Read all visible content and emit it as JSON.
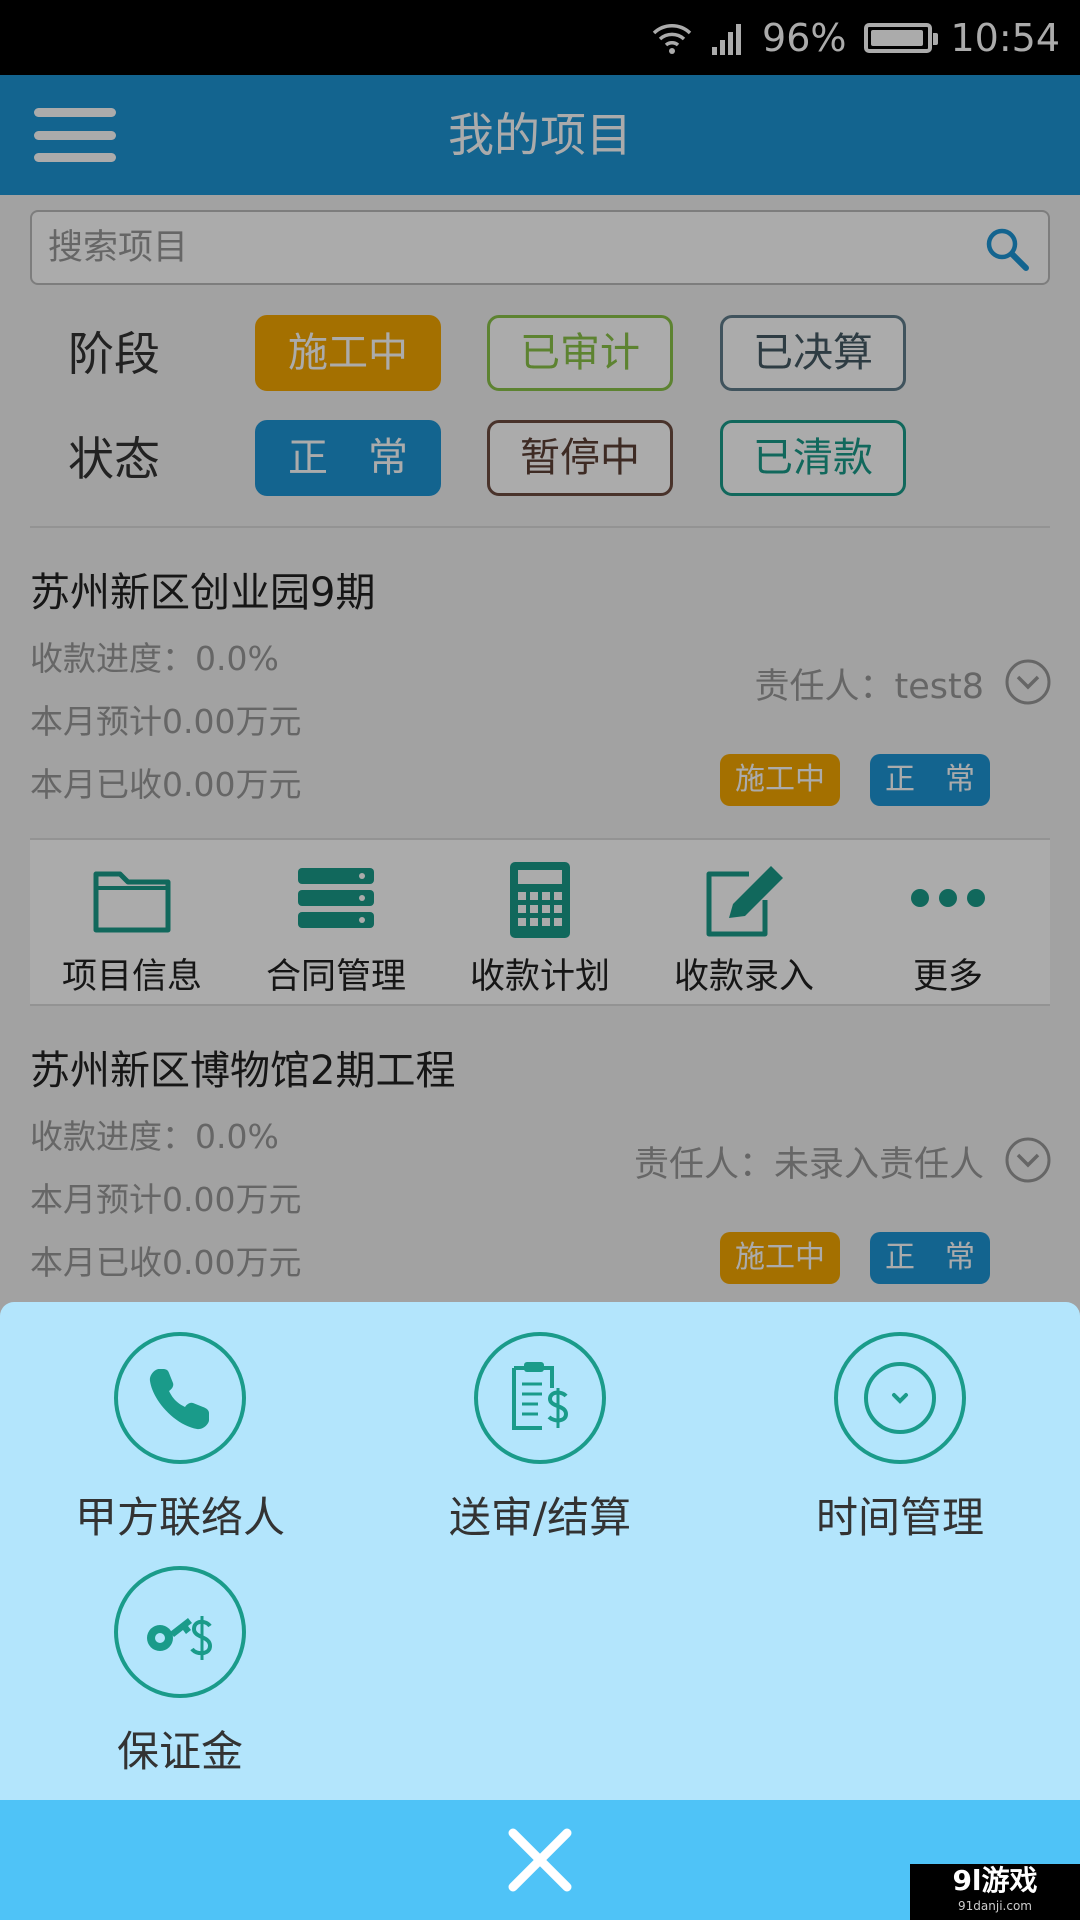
{
  "status": {
    "battery": "96%",
    "time": "10:54",
    "battery_level": 0.96
  },
  "header": {
    "title": "我的项目"
  },
  "search": {
    "placeholder": "搜索项目"
  },
  "filters": {
    "stage": {
      "label": "阶段",
      "options": [
        "施工中",
        "已审计",
        "已决算"
      ],
      "selected": "施工中"
    },
    "state": {
      "label": "状态",
      "options": [
        "正　常",
        "暂停中",
        "已清款"
      ],
      "selected": "正　常"
    }
  },
  "projects": [
    {
      "name": "苏州新区创业园9期",
      "progress": "收款进度：0.0%",
      "month_expected": "本月预计0.00万元",
      "month_received": "本月已收0.00万元",
      "owner": "责任人：test8",
      "tags": [
        "施工中",
        "正　常"
      ]
    },
    {
      "name": "苏州新区博物馆2期工程",
      "progress": "收款进度：0.0%",
      "month_expected": "本月预计0.00万元",
      "month_received": "本月已收0.00万元",
      "owner": "责任人：未录入责任人",
      "tags": [
        "施工中",
        "正　常"
      ]
    }
  ],
  "actions": [
    {
      "label": "项目信息",
      "icon": "folder-icon"
    },
    {
      "label": "合同管理",
      "icon": "server-list-icon"
    },
    {
      "label": "收款计划",
      "icon": "calculator-icon"
    },
    {
      "label": "收款录入",
      "icon": "edit-icon"
    },
    {
      "label": "更多",
      "icon": "more-dots-icon"
    }
  ],
  "sheet": {
    "items": [
      {
        "label": "甲方联络人",
        "icon": "phone-icon"
      },
      {
        "label": "送审/结算",
        "icon": "clipboard-dollar-icon"
      },
      {
        "label": "时间管理",
        "icon": "time-chevron-icon"
      },
      {
        "label": "保证金",
        "icon": "key-dollar-icon"
      }
    ],
    "close_icon": "close-icon"
  },
  "watermark": {
    "logo": "9l游戏",
    "url": "91danji.com"
  },
  "colors": {
    "primary": "#1d95d6",
    "orange": "#f5a700",
    "green": "#8bc34a",
    "slate": "#607d8b",
    "brown": "#6d4c41",
    "teal": "#1a9b8a",
    "sheet": "#b3e5fc",
    "close_bar": "#4fc3f7"
  }
}
